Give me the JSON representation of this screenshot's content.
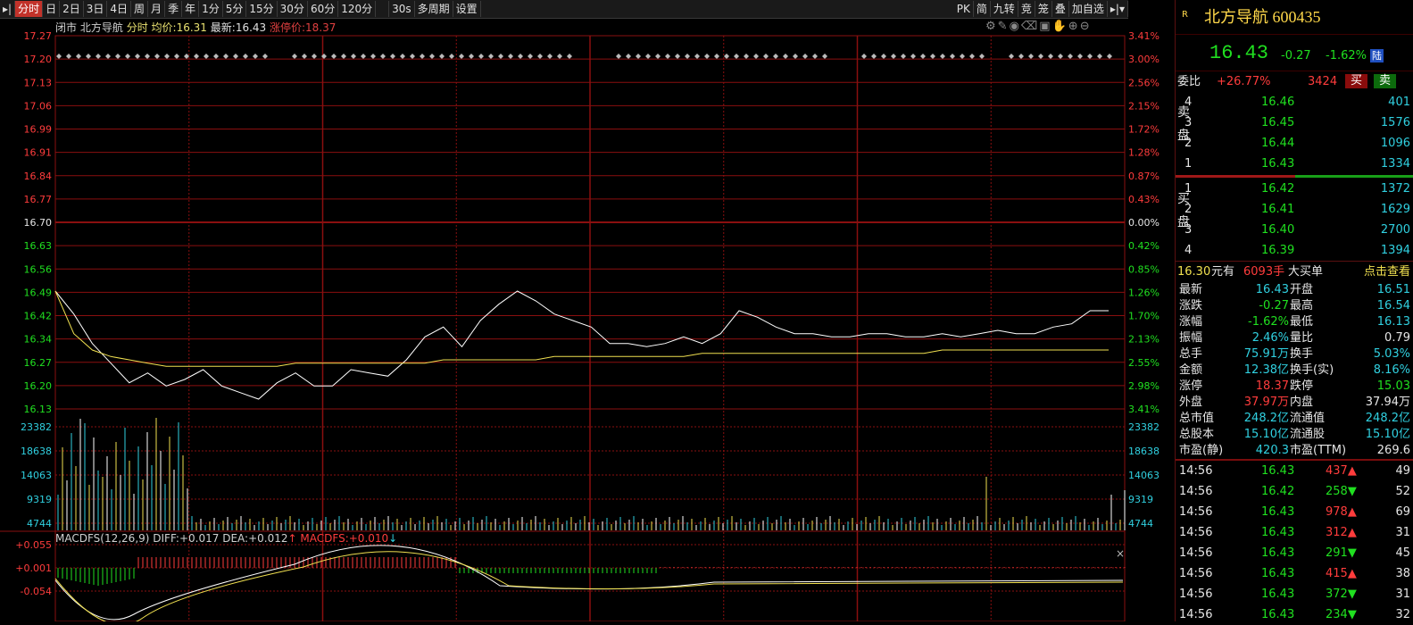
{
  "toolbar": {
    "items": [
      "分时",
      "日",
      "2日",
      "3日",
      "4日",
      "周",
      "月",
      "季",
      "年",
      "1分",
      "5分",
      "15分",
      "30分",
      "60分",
      "120分",
      "30s",
      "多周期",
      "设置"
    ],
    "right_items": [
      "PK",
      "简",
      "九转",
      "竞",
      "笼",
      "叠",
      "加自选"
    ]
  },
  "info": {
    "status": "闭市",
    "stock": "北方导航",
    "mode": "分时",
    "avg_label": "均价:",
    "avg": "16.31",
    "last_label": "最新:",
    "last": "16.43",
    "limit_label": "涨停价:",
    "limit": "18.37"
  },
  "macd": {
    "name": "MACDFS(12,26,9)",
    "diff_label": "DIFF:",
    "diff": "+0.017",
    "dea_label": "DEA:",
    "dea": "+0.012",
    "macdfs_label": "MACDFS:",
    "macdfs": "+0.010"
  },
  "axes": {
    "price_ticks": [
      "17.27",
      "17.20",
      "17.13",
      "17.06",
      "16.99",
      "16.91",
      "16.84",
      "16.77",
      "16.70",
      "16.63",
      "16.56",
      "16.49",
      "16.42",
      "16.34",
      "16.27",
      "16.20",
      "16.13"
    ],
    "pct_ticks": [
      "3.41%",
      "3.00%",
      "2.56%",
      "2.15%",
      "1.72%",
      "1.28%",
      "0.87%",
      "0.43%",
      "0.00%",
      "0.42%",
      "0.85%",
      "1.26%",
      "1.70%",
      "2.13%",
      "2.55%",
      "2.98%",
      "3.41%"
    ],
    "vol_ticks": [
      "23382",
      "18638",
      "14063",
      "9319",
      "4744"
    ],
    "macd_ticks": [
      "+0.055",
      "+0.001",
      "-0.054"
    ]
  },
  "colors": {
    "up": "#ff3c3c",
    "down": "#20e020",
    "grid": "#8a0f0f",
    "price_line": "#ffffff",
    "avg_line": "#f0e050"
  },
  "chart_data": {
    "type": "line",
    "prev_close": 16.7,
    "ylim": [
      16.13,
      17.27
    ],
    "series": [
      {
        "name": "最新",
        "values": [
          16.49,
          16.42,
          16.33,
          16.27,
          16.21,
          16.24,
          16.2,
          16.22,
          16.25,
          16.2,
          16.18,
          16.16,
          16.21,
          16.24,
          16.2,
          16.2,
          16.25,
          16.24,
          16.23,
          16.28,
          16.35,
          16.38,
          16.32,
          16.4,
          16.45,
          16.49,
          16.46,
          16.42,
          16.4,
          16.38,
          16.33,
          16.33,
          16.32,
          16.33,
          16.35,
          16.33,
          16.36,
          16.43,
          16.41,
          16.38,
          16.36,
          16.36,
          16.35,
          16.35,
          16.36,
          16.36,
          16.35,
          16.35,
          16.36,
          16.35,
          16.36,
          16.37,
          16.36,
          16.36,
          16.38,
          16.39,
          16.43,
          16.43
        ]
      },
      {
        "name": "均价",
        "values": [
          16.49,
          16.36,
          16.31,
          16.29,
          16.28,
          16.27,
          16.26,
          16.26,
          16.26,
          16.26,
          16.26,
          16.26,
          16.26,
          16.27,
          16.27,
          16.27,
          16.27,
          16.27,
          16.27,
          16.27,
          16.27,
          16.28,
          16.28,
          16.28,
          16.28,
          16.28,
          16.28,
          16.29,
          16.29,
          16.29,
          16.29,
          16.29,
          16.29,
          16.29,
          16.29,
          16.3,
          16.3,
          16.3,
          16.3,
          16.3,
          16.3,
          16.3,
          16.3,
          16.3,
          16.3,
          16.3,
          16.3,
          16.3,
          16.31,
          16.31,
          16.31,
          16.31,
          16.31,
          16.31,
          16.31,
          16.31,
          16.31,
          16.31
        ]
      }
    ]
  },
  "panel": {
    "name": "北方导航 600435",
    "price": "16.43",
    "change": "-0.27",
    "pct": "-1.62%",
    "lu": "陆",
    "weibi_label": "委比",
    "weibi": "+26.77%",
    "weicha": "3424",
    "buy_btn": "买",
    "sell_btn": "卖",
    "sell_label": "卖盘",
    "buy_label": "买盘",
    "sells": [
      {
        "lv": "4",
        "p": "16.46",
        "v": "401"
      },
      {
        "lv": "3",
        "p": "16.45",
        "v": "1576"
      },
      {
        "lv": "2",
        "p": "16.44",
        "v": "1096"
      },
      {
        "lv": "1",
        "p": "16.43",
        "v": "1334"
      }
    ],
    "buys": [
      {
        "lv": "1",
        "p": "16.42",
        "v": "1372"
      },
      {
        "lv": "2",
        "p": "16.41",
        "v": "1629"
      },
      {
        "lv": "3",
        "p": "16.40",
        "v": "2700"
      },
      {
        "lv": "4",
        "p": "16.39",
        "v": "1394"
      }
    ],
    "big": {
      "price": "16.30",
      "yuan": "元有",
      "hands": "6093手",
      "label": "大买单",
      "link": "点击查看"
    },
    "stats": [
      [
        "最新",
        "16.43",
        "开盘",
        "16.51"
      ],
      [
        "涨跌",
        "-0.27",
        "最高",
        "16.54"
      ],
      [
        "涨幅",
        "-1.62%",
        "最低",
        "16.13"
      ],
      [
        "振幅",
        "2.46%",
        "量比",
        "0.79"
      ],
      [
        "总手",
        "75.91万",
        "换手",
        "5.03%"
      ],
      [
        "金额",
        "12.38亿",
        "换手(实)",
        "8.16%"
      ],
      [
        "涨停",
        "18.37",
        "跌停",
        "15.03"
      ],
      [
        "外盘",
        "37.97万",
        "内盘",
        "37.94万"
      ],
      [
        "总市值",
        "248.2亿",
        "流通值",
        "248.2亿"
      ],
      [
        "总股本",
        "15.10亿",
        "流通股",
        "15.10亿"
      ],
      [
        "市盈(静)",
        "420.3",
        "市盈(TTM)",
        "269.6"
      ]
    ],
    "ticks": [
      {
        "t": "14:56",
        "p": "16.43",
        "v": "437",
        "d": "up",
        "n": "49"
      },
      {
        "t": "14:56",
        "p": "16.42",
        "v": "258",
        "d": "down",
        "n": "52"
      },
      {
        "t": "14:56",
        "p": "16.43",
        "v": "978",
        "d": "up",
        "n": "69"
      },
      {
        "t": "14:56",
        "p": "16.43",
        "v": "312",
        "d": "up",
        "n": "31"
      },
      {
        "t": "14:56",
        "p": "16.43",
        "v": "291",
        "d": "down",
        "n": "45"
      },
      {
        "t": "14:56",
        "p": "16.43",
        "v": "415",
        "d": "up",
        "n": "38"
      },
      {
        "t": "14:56",
        "p": "16.43",
        "v": "372",
        "d": "down",
        "n": "31"
      },
      {
        "t": "14:56",
        "p": "16.43",
        "v": "234",
        "d": "down",
        "n": "32"
      }
    ]
  }
}
